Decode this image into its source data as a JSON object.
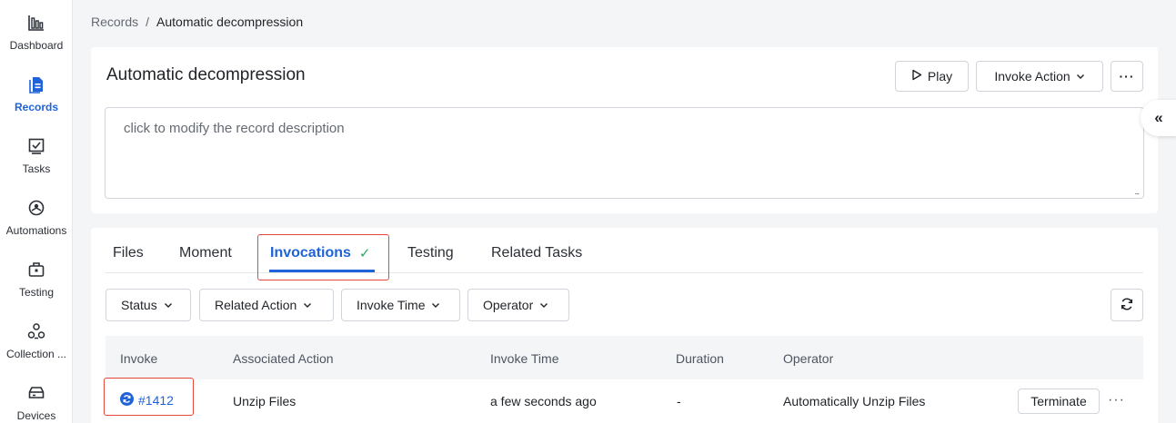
{
  "sidebar": {
    "items": [
      {
        "label": "Dashboard",
        "icon": "dashboard-icon",
        "active": false
      },
      {
        "label": "Records",
        "icon": "records-icon",
        "active": true
      },
      {
        "label": "Tasks",
        "icon": "tasks-icon",
        "active": false
      },
      {
        "label": "Automations",
        "icon": "automations-icon",
        "active": false
      },
      {
        "label": "Testing",
        "icon": "testing-icon",
        "active": false
      },
      {
        "label": "Collection ...",
        "icon": "collection-icon",
        "active": false
      },
      {
        "label": "Devices",
        "icon": "devices-icon",
        "active": false
      }
    ]
  },
  "breadcrumb": {
    "parent": "Records",
    "separator": "/",
    "current": "Automatic decompression"
  },
  "record": {
    "title": "Automatic decompression",
    "play_label": "Play",
    "invoke_action_label": "Invoke Action",
    "more_label": "···",
    "description_placeholder": "click to modify the record description",
    "resize_mark": "..."
  },
  "collapse": {
    "label": "«"
  },
  "tabs": [
    {
      "label": "Files"
    },
    {
      "label": "Moment"
    },
    {
      "label": "Invocations",
      "active": true,
      "check": "✓"
    },
    {
      "label": "Testing"
    },
    {
      "label": "Related Tasks"
    }
  ],
  "filters": [
    {
      "label": "Status"
    },
    {
      "label": "Related Action"
    },
    {
      "label": "Invoke Time"
    },
    {
      "label": "Operator"
    }
  ],
  "table": {
    "columns": [
      "Invoke",
      "Associated Action",
      "Invoke Time",
      "Duration",
      "Operator"
    ],
    "rows": [
      {
        "invoke": "#1412",
        "action": "Unzip Files",
        "time": "a few seconds ago",
        "duration": "-",
        "operator": "Automatically Unzip Files",
        "terminate_label": "Terminate",
        "more_label": "···"
      }
    ]
  },
  "colors": {
    "accent": "#2063d9",
    "highlight": "#e8483b",
    "success": "#2fa36b"
  }
}
